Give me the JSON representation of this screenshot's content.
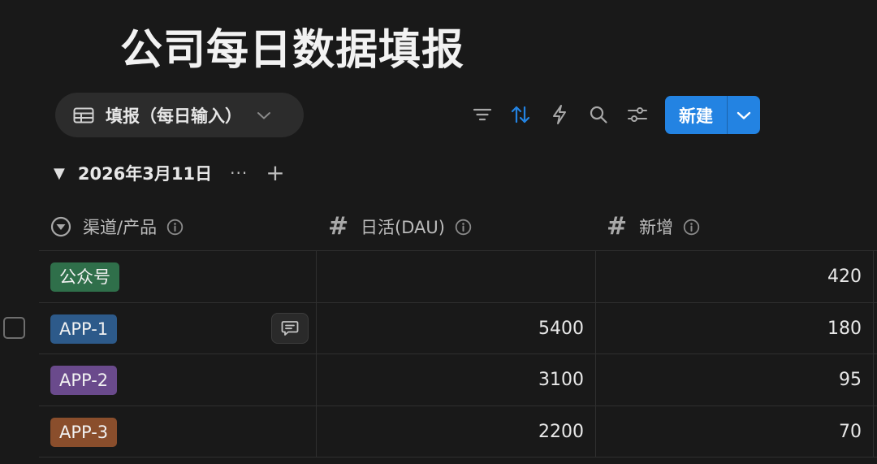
{
  "page": {
    "title": "公司每日数据填报"
  },
  "view": {
    "tab_label": "填报（每日输入）",
    "icon": "table-icon"
  },
  "toolbar": {
    "tools": [
      "filter-icon",
      "sort-icon",
      "automation-bolt-icon",
      "search-icon",
      "settings-sliders-icon"
    ],
    "new_label": "新建",
    "new_color": "#2383e2",
    "sort_active_color": "#2383e2"
  },
  "group": {
    "date": "2026年3月11日",
    "more": "···",
    "add": "+"
  },
  "columns": [
    {
      "label": "渠道/产品",
      "icon": "select-icon"
    },
    {
      "label": "日活(DAU)",
      "icon": "number-hash-icon"
    },
    {
      "label": "新增",
      "icon": "number-hash-icon"
    }
  ],
  "rows": [
    {
      "channel": "公众号",
      "tag_color": "#2f6f4a",
      "dau": "",
      "new": "420"
    },
    {
      "channel": "APP-1",
      "tag_color": "#2d5a8a",
      "dau": "5400",
      "new": "180"
    },
    {
      "channel": "APP-2",
      "tag_color": "#6a4a8c",
      "dau": "3100",
      "new": "95"
    },
    {
      "channel": "APP-3",
      "tag_color": "#8a4e2c",
      "dau": "2200",
      "new": "70"
    }
  ]
}
